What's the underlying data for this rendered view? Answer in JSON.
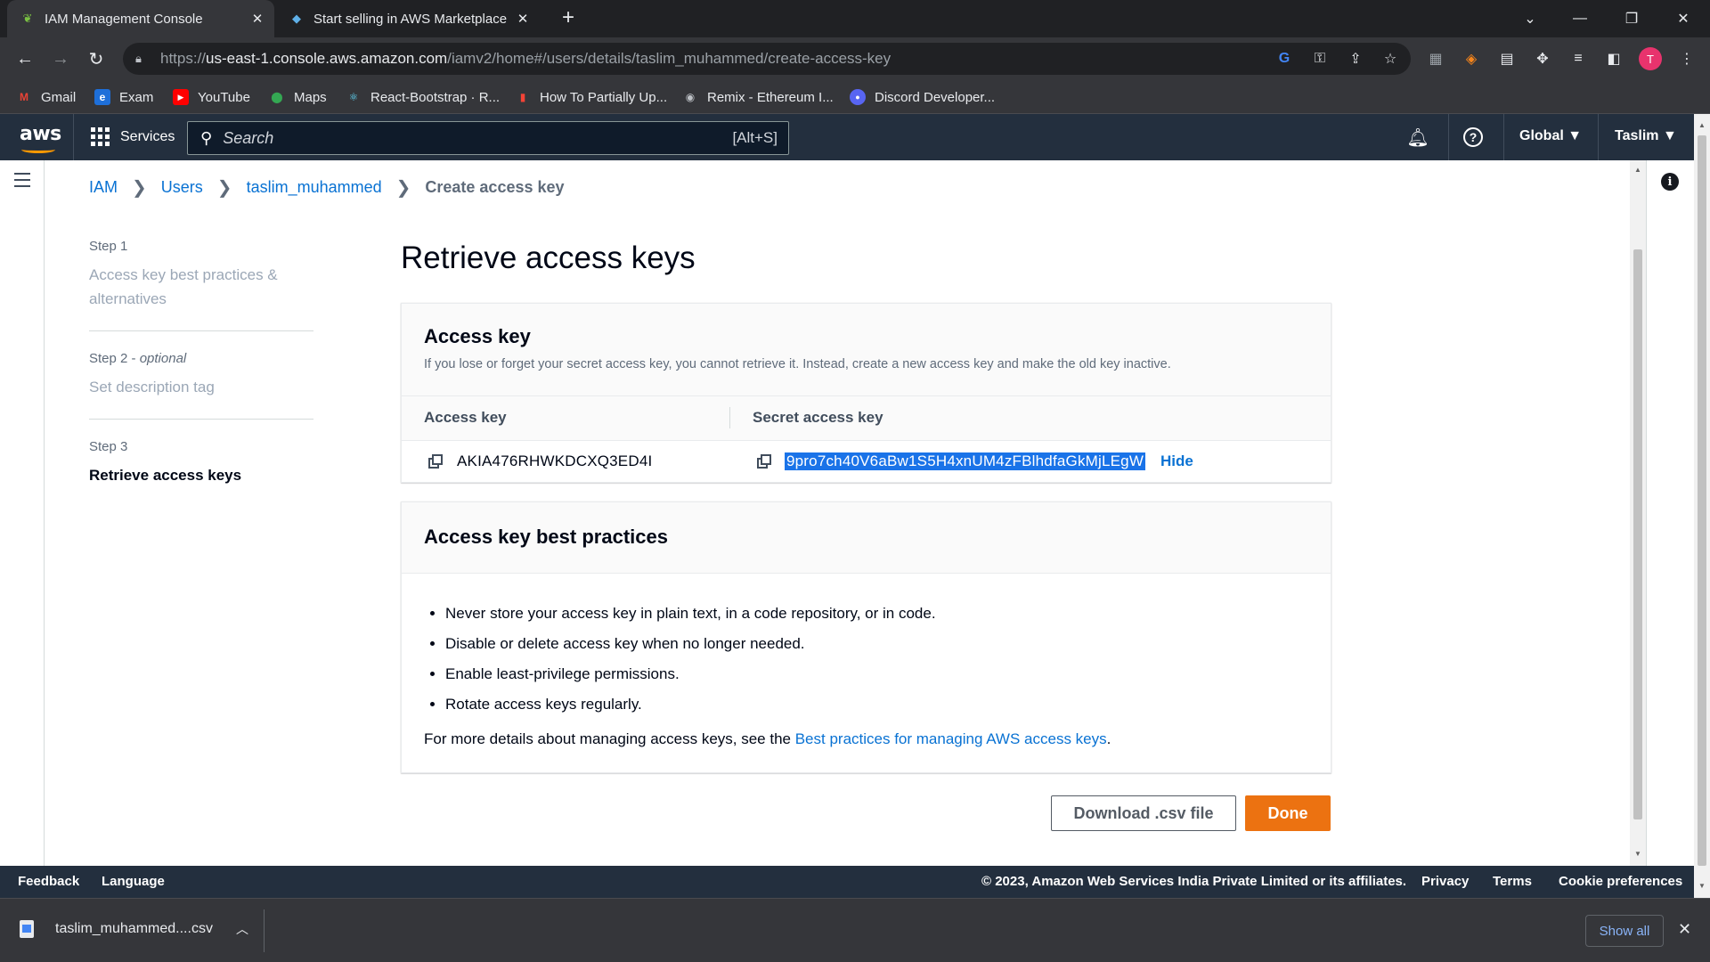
{
  "browser": {
    "tabs": [
      {
        "title": "IAM Management Console",
        "active": true,
        "icon": "aws-console-icon"
      },
      {
        "title": "Start selling in AWS Marketplace",
        "active": false,
        "icon": "marketplace-icon"
      }
    ],
    "url_prefix": "https://",
    "url_host": "us-east-1.console.aws.amazon.com",
    "url_path": "/iamv2/home#/users/details/taslim_muhammed/create-access-key",
    "profile_initial": "T",
    "bookmarks": [
      {
        "label": "Gmail",
        "icon": "gmail-icon"
      },
      {
        "label": "Exam",
        "icon": "exam-icon"
      },
      {
        "label": "YouTube",
        "icon": "youtube-icon"
      },
      {
        "label": "Maps",
        "icon": "maps-icon"
      },
      {
        "label": "React-Bootstrap · R...",
        "icon": "react-bootstrap-icon"
      },
      {
        "label": "How To Partially Up...",
        "icon": "bookmark-icon"
      },
      {
        "label": "Remix - Ethereum I...",
        "icon": "remix-icon"
      },
      {
        "label": "Discord Developer...",
        "icon": "discord-icon"
      }
    ]
  },
  "aws_nav": {
    "logo": "aws",
    "services_label": "Services",
    "search_placeholder": "Search",
    "search_shortcut": "[Alt+S]",
    "region_label": "Global",
    "user_label": "Taslim"
  },
  "breadcrumb": {
    "items": [
      "IAM",
      "Users",
      "taslim_muhammed"
    ],
    "current": "Create access key"
  },
  "steps": [
    {
      "num": "Step 1",
      "optional": "",
      "name": "Access key best practices & alternatives",
      "current": false
    },
    {
      "num": "Step 2 - ",
      "optional": "optional",
      "name": "Set description tag",
      "current": false
    },
    {
      "num": "Step 3",
      "optional": "",
      "name": "Retrieve access keys",
      "current": true
    }
  ],
  "page_title": "Retrieve access keys",
  "access_key_card": {
    "title": "Access key",
    "description": "If you lose or forget your secret access key, you cannot retrieve it. Instead, create a new access key and make the old key inactive.",
    "col_access_key": "Access key",
    "col_secret_key": "Secret access key",
    "access_key_value": "AKIA476RHWKDCXQ3ED4I",
    "secret_key_value": "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",
    "hide_label": "Hide"
  },
  "best_practices_card": {
    "title": "Access key best practices",
    "items": [
      "Never store your access key in plain text, in a code repository, or in code.",
      "Disable or delete access key when no longer needed.",
      "Enable least-privilege permissions.",
      "Rotate access keys regularly."
    ],
    "more_prefix": "For more details about managing access keys, see the ",
    "more_link": "Best practices for managing AWS access keys",
    "more_suffix": "."
  },
  "actions": {
    "download_label": "Download .csv file",
    "done_label": "Done"
  },
  "footer": {
    "feedback": "Feedback",
    "language": "Language",
    "copyright": "© 2023, Amazon Web Services India Private Limited or its affiliates.",
    "privacy": "Privacy",
    "terms": "Terms",
    "cookies": "Cookie preferences"
  },
  "downloads": {
    "file_name": "taslim_muhammed....csv",
    "show_all": "Show all"
  },
  "colors": {
    "aws_nav_bg": "#232f3e",
    "aws_orange": "#ec7211",
    "link_blue": "#0972d3",
    "selection_blue": "#1a73e8"
  }
}
